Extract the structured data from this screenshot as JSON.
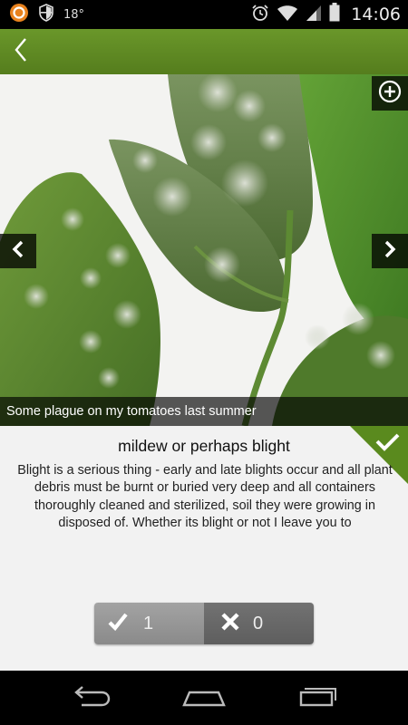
{
  "status_bar": {
    "temperature": "18°",
    "time": "14:06",
    "icons": [
      "app-notification-icon",
      "shield-icon",
      "alarm-icon",
      "wifi-icon",
      "signal-icon",
      "battery-icon"
    ]
  },
  "app_bar": {
    "back_icon": "chevron-left-icon",
    "color": "#5f8a24"
  },
  "photo": {
    "caption": "Some plague on my tomatoes last summer",
    "zoom_icon": "zoom-in-icon",
    "prev_icon": "chevron-left-icon",
    "next_icon": "chevron-right-icon"
  },
  "answer": {
    "title": "mildew or perhaps blight",
    "body": "Blight is a serious thing - early and late blights occur and all plant debris must be burnt or buried very deep and all containers thoroughly cleaned and sterilized, soil they were growing in disposed of. Whether its blight or not I leave you to",
    "accepted_icon": "checkmark-icon",
    "accent_color": "#5a8a1e"
  },
  "votes": {
    "up_count": "1",
    "down_count": "0",
    "up_icon": "checkmark-icon",
    "down_icon": "cross-icon"
  },
  "nav_bar": {
    "icons": [
      "back-icon",
      "home-icon",
      "recent-apps-icon"
    ]
  }
}
